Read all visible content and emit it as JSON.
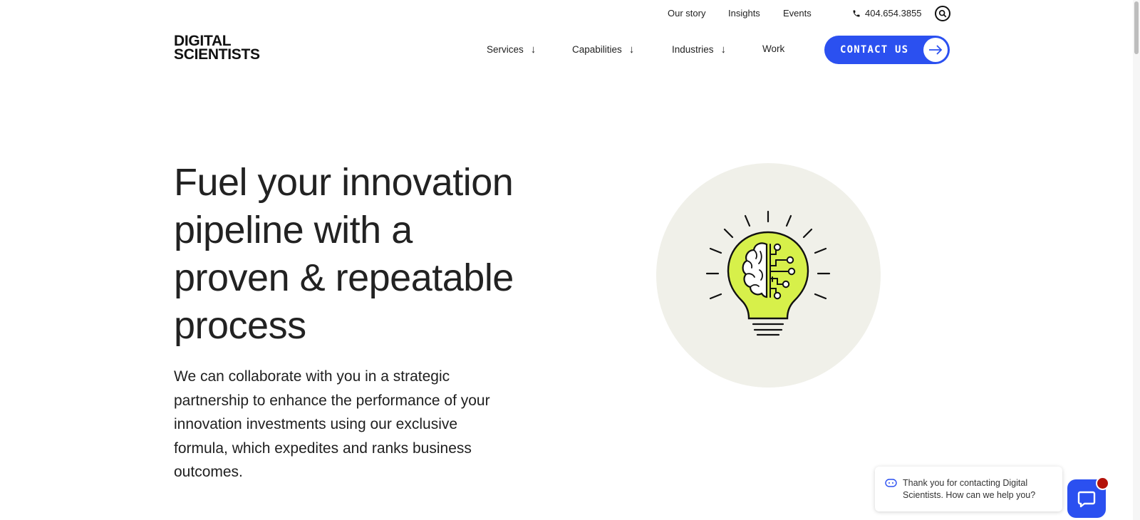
{
  "utility": {
    "links": [
      "Our story",
      "Insights",
      "Events"
    ],
    "phone": "404.654.3855"
  },
  "logo": {
    "line1": "DIGITAL",
    "line2": "SCIENTISTS"
  },
  "nav": {
    "items": [
      {
        "label": "Services",
        "has_dropdown": true
      },
      {
        "label": "Capabilities",
        "has_dropdown": true
      },
      {
        "label": "Industries",
        "has_dropdown": true
      },
      {
        "label": "Work",
        "has_dropdown": false
      }
    ],
    "cta": "CONTACT US"
  },
  "hero": {
    "title_lines": [
      "Fuel your innovation",
      "pipeline with a",
      "proven & repeatable",
      "process"
    ],
    "body_lines": [
      "We can collaborate with you in a strategic",
      "partnership to enhance the performance of your",
      "innovation investments using our exclusive",
      "formula, which expedites and ranks business",
      "outcomes."
    ]
  },
  "chat": {
    "message_line1": "Thank you for contacting Digital",
    "message_line2": "Scientists. How can we help you?"
  },
  "colors": {
    "accent": "#2b50f0",
    "bulb": "#d7f04a",
    "illustration_bg": "#f0f0e9",
    "badge": "#b3120a"
  },
  "icons": {
    "nav_dropdown": "arrow-down-icon",
    "phone": "phone-icon",
    "search": "search-icon",
    "cta": "arrow-right-icon",
    "illustration": "lightbulb-brain-icon",
    "chat_bot": "chatbot-icon",
    "chat_launch": "chat-icon"
  }
}
